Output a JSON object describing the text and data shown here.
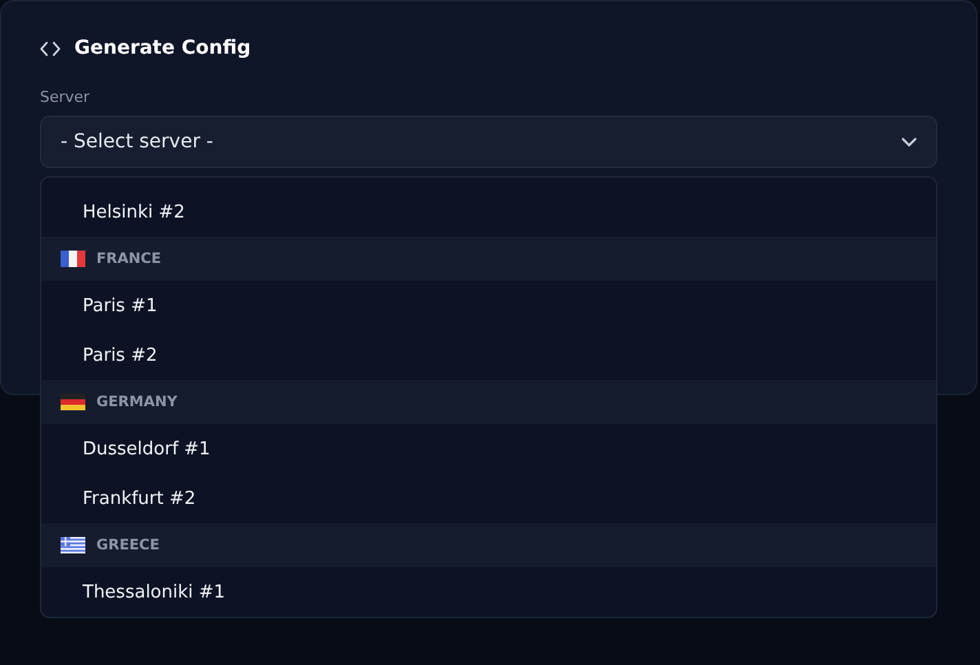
{
  "card": {
    "title": "Generate Config"
  },
  "server_field": {
    "label": "Server",
    "value": "- Select server -"
  },
  "dropdown": {
    "items": [
      {
        "kind": "option",
        "label": "Helsinki #2"
      },
      {
        "kind": "french",
        "label": "FRANCE"
      },
      {
        "kind": "option",
        "label": "Paris #1"
      },
      {
        "kind": "option",
        "label": "Paris #2"
      },
      {
        "kind": "german",
        "label": "GERMANY"
      },
      {
        "kind": "option",
        "label": "Dusseldorf #1"
      },
      {
        "kind": "option",
        "label": "Frankfurt #2"
      },
      {
        "kind": "greek",
        "label": "GREECE"
      },
      {
        "kind": "option",
        "label": "Thessaloniki #1"
      }
    ]
  }
}
